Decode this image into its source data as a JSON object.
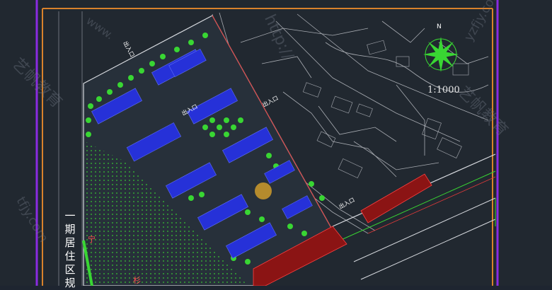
{
  "drawing": {
    "title_chars": [
      "一",
      "期",
      "居",
      "住",
      "区",
      "规"
    ],
    "scale": "1:1000",
    "north_label": "N",
    "entrances": {
      "e1": "出入口",
      "e2": "出入口",
      "e3": "出入口",
      "e4": "出入口"
    },
    "road_marks": {
      "ning": "宁",
      "bin": "杉"
    },
    "watermark_urls": [
      "www.",
      "http://",
      "yzfjy.com",
      "tfjy.com"
    ],
    "watermark_brand": "艺帆教育",
    "colors": {
      "background": "#212830",
      "frame_purple": "#8a2be2",
      "frame_orange": "#d9822b",
      "building_blue": "#2631d8",
      "tree_green": "#39d633",
      "red_block": "#8b1414",
      "road_white": "#d8dbe0"
    }
  }
}
